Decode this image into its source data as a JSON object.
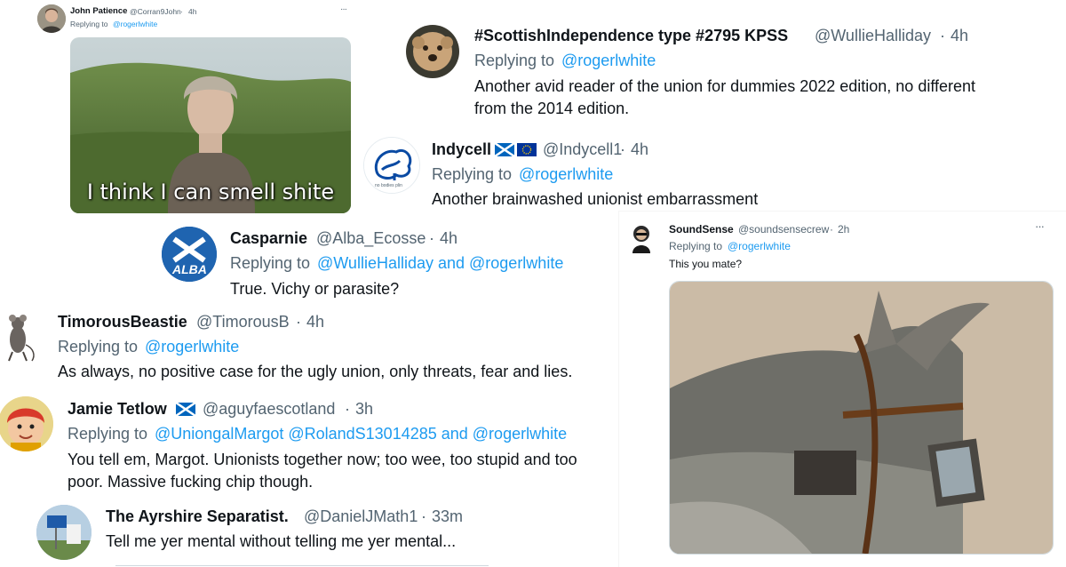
{
  "colors": {
    "link": "#1d9bf0",
    "meta": "#536471",
    "text": "#0f1419"
  },
  "tweets": [
    {
      "id": "t1",
      "name": "John Patience",
      "handle": "@Corran9John",
      "time": "4h",
      "replying_label": "Replying to",
      "replying_to": "@rogerlwhite",
      "more": "···",
      "image_caption": "I think I can smell shite",
      "avatar_icon": "man-avatar-icon"
    },
    {
      "id": "t2",
      "name": "#ScottishIndependence type #2795 KPSS",
      "handle": "@WullieHalliday",
      "time": "4h",
      "replying_label": "Replying to",
      "replying_to": "@rogerlwhite",
      "text_line1": "Another avid reader of the union for dummies 2022 edition, no different",
      "text_line2": "from the 2014 edition.",
      "avatar_icon": "dog-avatar-icon"
    },
    {
      "id": "t3",
      "name": "Indycell",
      "handle": "@Indycell1",
      "time": "4h",
      "replying_label": "Replying to",
      "replying_to": "@rogerlwhite",
      "text": "Another brainwashed unionist embarrassment",
      "avatar_icon": "tree-logo-avatar-icon",
      "avatar_caption": "no bodies plin"
    },
    {
      "id": "t4",
      "name": "Casparnie",
      "handle": "@Alba_Ecosse",
      "time": "4h",
      "replying_label": "Replying to",
      "replying_to": "@WullieHalliday and @rogerlwhite",
      "text": "True. Vichy or parasite?",
      "avatar_icon": "alba-logo-avatar-icon",
      "avatar_text": "ALBA"
    },
    {
      "id": "t5",
      "name": "TimorousBeastie",
      "handle": "@TimorousB",
      "time": "4h",
      "replying_label": "Replying to",
      "replying_to": "@rogerlwhite",
      "text": "As always, no positive case for the ugly union, only threats, fear and lies.",
      "avatar_icon": "mouse-avatar-icon"
    },
    {
      "id": "t6",
      "name": "Jamie Tetlow",
      "handle": "@aguyfaescotland",
      "time": "3h",
      "replying_label": "Replying to",
      "replying_to": "@UniongalMargot @RolandS13014285 and @rogerlwhite",
      "text_line1": "You tell em, Margot. Unionists together now; too wee, too stupid and too",
      "text_line2": "poor. Massive fucking chip though.",
      "more": "·",
      "avatar_icon": "cartoon-boy-avatar-icon"
    },
    {
      "id": "t7",
      "name": "The Ayrshire Separatist.",
      "handle": "@DanielJMath1",
      "time": "33m",
      "text": "Tell me yer mental without telling me yer mental...",
      "avatar_icon": "road-sign-avatar-icon"
    },
    {
      "id": "t8",
      "name": "SoundSense",
      "handle": "@soundsensecrew",
      "time": "2h",
      "replying_label": "Replying to",
      "replying_to": "@rogerlwhite",
      "text": "This you mate?",
      "more": "···",
      "avatar_icon": "hooded-figure-avatar-icon"
    }
  ]
}
